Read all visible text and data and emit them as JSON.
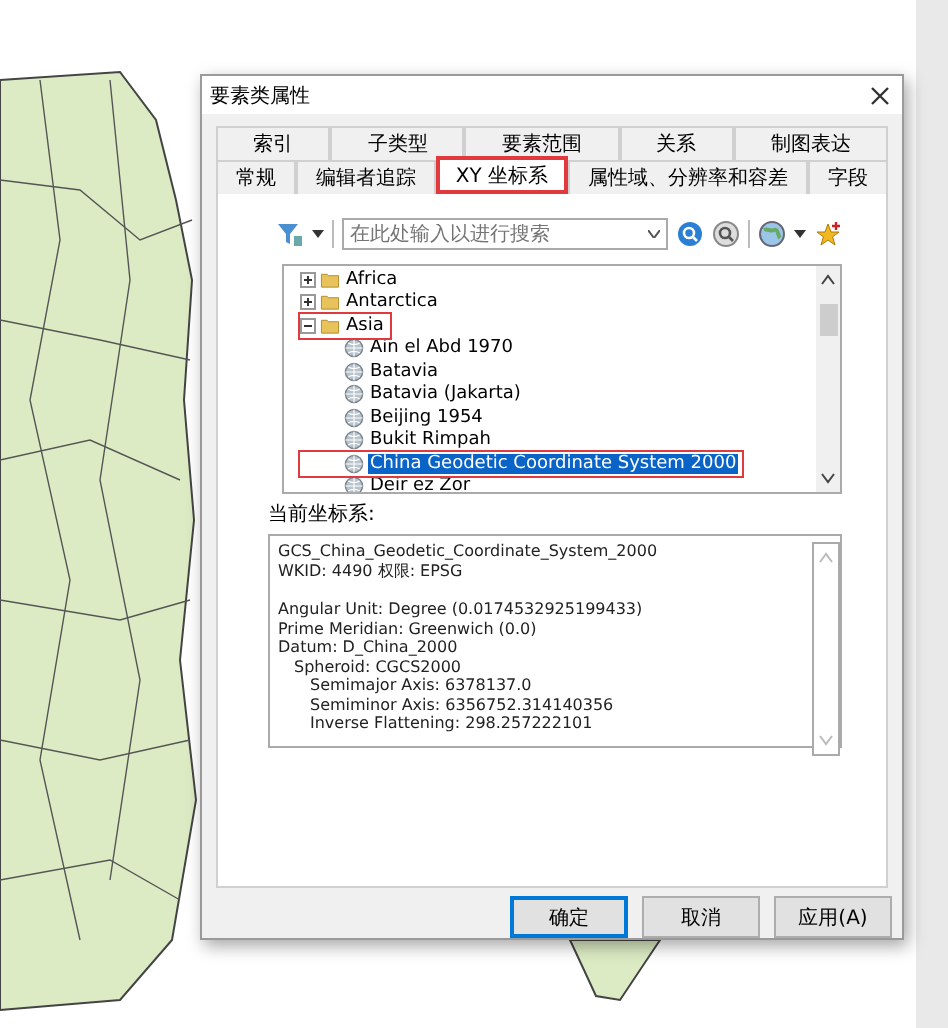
{
  "window": {
    "title": "要素类属性"
  },
  "tab_rows": [
    [
      {
        "label": "索引",
        "selected": false,
        "highlighted": false
      },
      {
        "label": "子类型",
        "selected": false,
        "highlighted": false
      },
      {
        "label": "要素范围",
        "selected": false,
        "highlighted": false
      },
      {
        "label": "关系",
        "selected": false,
        "highlighted": false
      },
      {
        "label": "制图表达",
        "selected": false,
        "highlighted": false
      }
    ],
    [
      {
        "label": "常规",
        "selected": false,
        "highlighted": false
      },
      {
        "label": "编辑者追踪",
        "selected": false,
        "highlighted": false
      },
      {
        "label": "XY 坐标系",
        "selected": true,
        "highlighted": true
      },
      {
        "label": "属性域、分辨率和容差",
        "selected": false,
        "highlighted": false
      },
      {
        "label": "字段",
        "selected": false,
        "highlighted": false
      }
    ]
  ],
  "search": {
    "placeholder": "在此处输入以进行搜索"
  },
  "tree": [
    {
      "label": "Africa",
      "kind": "folder",
      "expanded": false,
      "selected": false,
      "highlighted": false
    },
    {
      "label": "Antarctica",
      "kind": "folder",
      "expanded": false,
      "selected": false,
      "highlighted": false
    },
    {
      "label": "Asia",
      "kind": "folder",
      "expanded": true,
      "selected": false,
      "highlighted": true,
      "children": [
        {
          "label": "Ain el Abd 1970",
          "kind": "coordinate-system",
          "selected": false,
          "highlighted": false
        },
        {
          "label": "Batavia",
          "kind": "coordinate-system",
          "selected": false,
          "highlighted": false
        },
        {
          "label": "Batavia (Jakarta)",
          "kind": "coordinate-system",
          "selected": false,
          "highlighted": false
        },
        {
          "label": "Beijing 1954",
          "kind": "coordinate-system",
          "selected": false,
          "highlighted": false
        },
        {
          "label": "Bukit Rimpah",
          "kind": "coordinate-system",
          "selected": false,
          "highlighted": false
        },
        {
          "label": "China Geodetic Coordinate System 2000",
          "kind": "coordinate-system",
          "selected": true,
          "highlighted": true
        },
        {
          "label": "Deir ez Zor",
          "kind": "coordinate-system",
          "selected": false,
          "highlighted": false
        }
      ]
    }
  ],
  "current": {
    "label": "当前坐标系:",
    "paragraphs": [
      [
        {
          "text": "GCS_China_Geodetic_Coordinate_System_2000"
        },
        {
          "text": "WKID: 4490 权限: EPSG"
        }
      ],
      [
        {
          "text": "Angular Unit: Degree (0.0174532925199433)"
        },
        {
          "text": "Prime Meridian: Greenwich (0.0)"
        },
        {
          "text": "Datum: D_China_2000",
          "children": [
            {
              "text": "Spheroid: CGCS2000",
              "children": [
                {
                  "text": "Semimajor Axis: 6378137.0"
                },
                {
                  "text": "Semiminor Axis: 6356752.314140356"
                },
                {
                  "text": "Inverse Flattening: 298.257222101"
                }
              ]
            }
          ]
        }
      ]
    ]
  },
  "buttons": [
    {
      "label": "确定",
      "default": true
    },
    {
      "label": "取消",
      "default": false
    },
    {
      "label": "应用(A)",
      "default": false
    }
  ]
}
